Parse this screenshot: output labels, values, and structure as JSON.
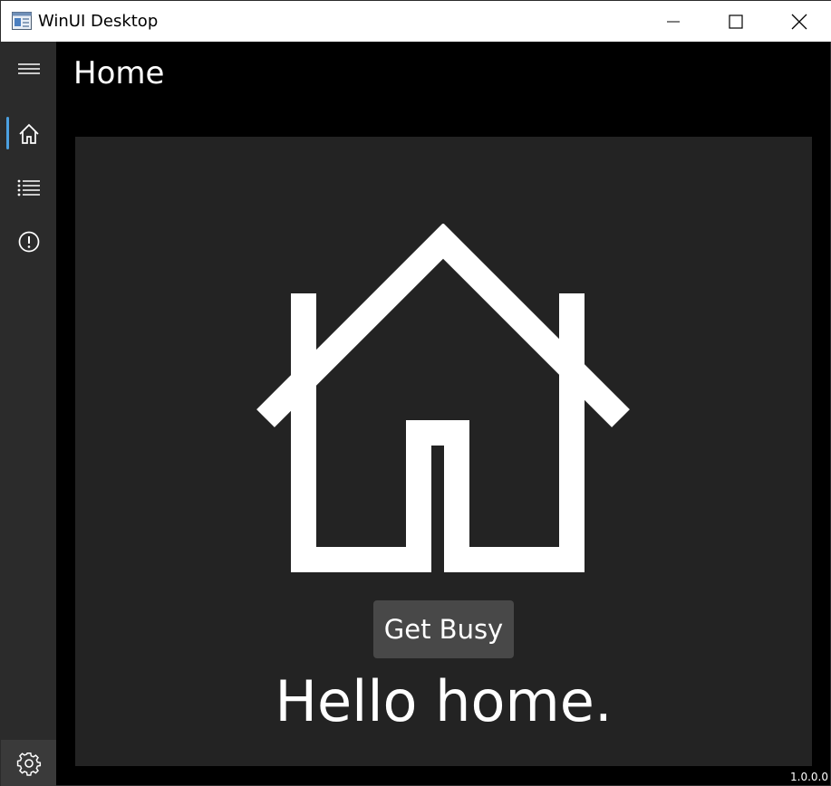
{
  "window": {
    "title": "WinUI Desktop"
  },
  "nav": {
    "items": [
      {
        "icon": "hamburger-icon"
      },
      {
        "icon": "home-icon",
        "selected": true
      },
      {
        "icon": "list-icon"
      },
      {
        "icon": "alert-icon"
      }
    ],
    "settings_icon": "gear-icon",
    "accent": "#4ca0e0"
  },
  "page": {
    "title": "Home",
    "hero_icon": "house-icon",
    "button_label": "Get Busy",
    "message": "Hello home."
  },
  "status": {
    "version": "1.0.0.0"
  }
}
